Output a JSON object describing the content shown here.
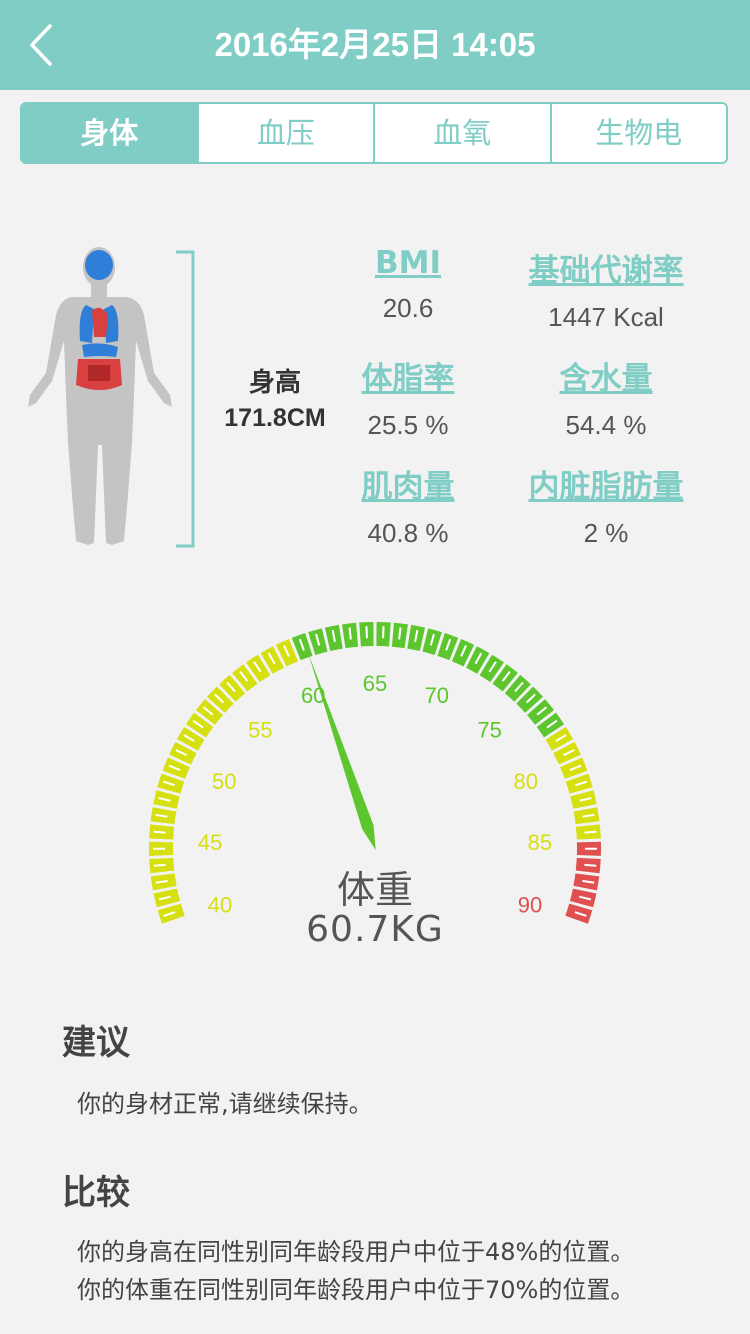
{
  "header": {
    "title": "2016年2月25日 14:05",
    "back_icon": "chevron-left-icon"
  },
  "tabs": [
    {
      "label": "身体",
      "active": true
    },
    {
      "label": "血压",
      "active": false
    },
    {
      "label": "血氧",
      "active": false
    },
    {
      "label": "生物电",
      "active": false
    }
  ],
  "body_figure_icon": "human-body-organs-icon",
  "height": {
    "label": "身高",
    "value": "171.8CM"
  },
  "metrics": [
    {
      "label": "BMI",
      "value": "20.6"
    },
    {
      "label": "基础代谢率",
      "value": "1447 Kcal"
    },
    {
      "label": "体脂率",
      "value": "25.5 %"
    },
    {
      "label": "含水量",
      "value": "54.4 %"
    },
    {
      "label": "肌肉量",
      "value": "40.8 %"
    },
    {
      "label": "内脏脂肪量",
      "value": "2 %"
    }
  ],
  "gauge": {
    "label": "体重",
    "value_text": "60.7KG",
    "reading": 60.7,
    "min": 40,
    "max": 90,
    "ticks": [
      "40",
      "45",
      "50",
      "55",
      "60",
      "65",
      "70",
      "75",
      "80",
      "85",
      "90"
    ],
    "colors": {
      "yellow": "#d6df10",
      "green": "#5dc62f",
      "red": "#e05050"
    }
  },
  "advice": {
    "title": "建议",
    "text": "你的身材正常,请继续保持。"
  },
  "compare": {
    "title": "比较",
    "lines": [
      "你的身高在同性别同年龄段用户中位于48%的位置。",
      "你的体重在同性别同年龄段用户中位于70%的位置。"
    ]
  },
  "colors": {
    "accent": "#7fcdc5",
    "background": "#f2f2f2"
  }
}
